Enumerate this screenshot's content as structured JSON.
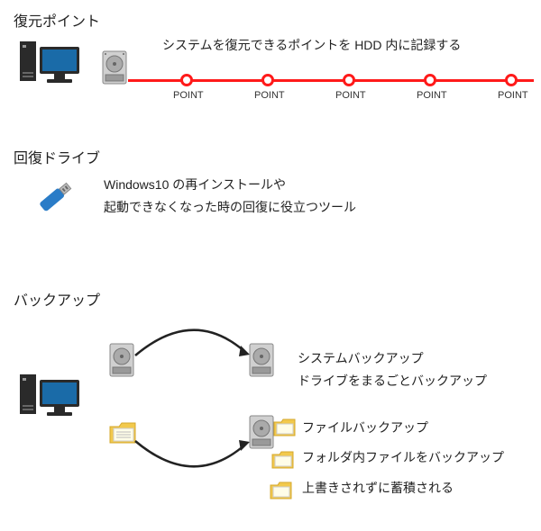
{
  "section1": {
    "title": "復元ポイント",
    "description": "システムを復元できるポイントを HDD 内に記録する",
    "points": [
      "POINT",
      "POINT",
      "POINT",
      "POINT",
      "POINT"
    ]
  },
  "section2": {
    "title": "回復ドライブ",
    "line1": "Windows10 の再インストールや",
    "line2": "起動できなくなった時の回復に役立つツール"
  },
  "section3": {
    "title": "バックアップ",
    "system_title": "システムバックアップ",
    "system_desc": "ドライブをまるごとバックアップ",
    "file_title": "ファイルバックアップ",
    "file_desc": "フォルダ内ファイルをバックアップ",
    "file_note": "上書きされずに蓄積される"
  }
}
